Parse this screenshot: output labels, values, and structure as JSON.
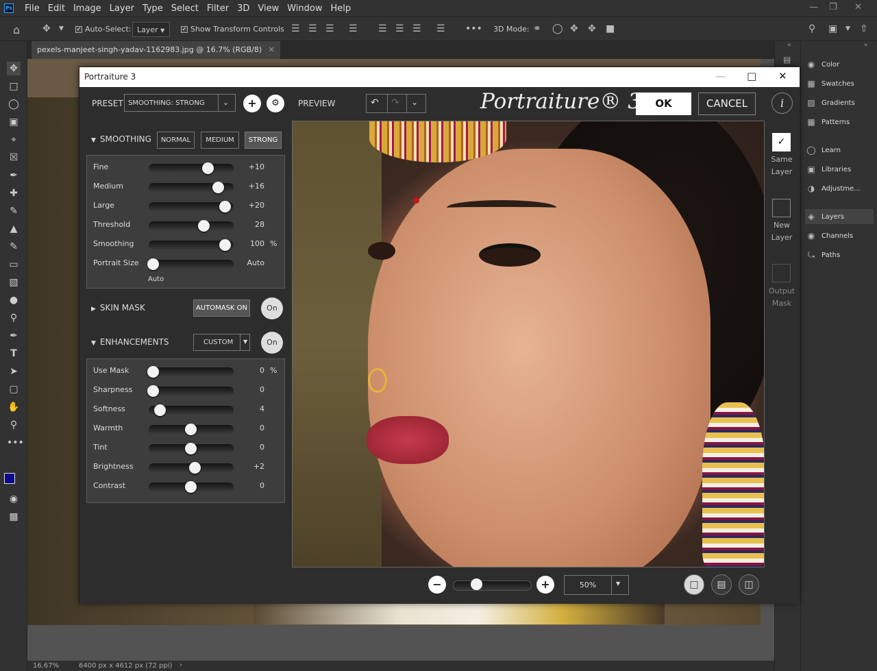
{
  "app": {
    "menu": [
      "File",
      "Edit",
      "Image",
      "Layer",
      "Type",
      "Select",
      "Filter",
      "3D",
      "View",
      "Window",
      "Help"
    ],
    "logo": "Ps"
  },
  "options": {
    "auto_select_label": "Auto-Select:",
    "auto_select_value": "Layer",
    "transform_label": "Show Transform Controls",
    "mode_label": "3D Mode:"
  },
  "document": {
    "tab_title": "pexels-manjeet-singh-yadav-1162983.jpg @ 16.7% (RGB/8)",
    "zoom": "16.67%",
    "dimensions": "6400 px x 4612 px (72 ppi)"
  },
  "panels": {
    "items": [
      {
        "label": "Color",
        "icon": "palette-icon"
      },
      {
        "label": "Swatches",
        "icon": "grid-icon"
      },
      {
        "label": "Gradients",
        "icon": "gradient-icon"
      },
      {
        "label": "Patterns",
        "icon": "pattern-icon"
      },
      {
        "label": "Learn",
        "icon": "lightbulb-icon"
      },
      {
        "label": "Libraries",
        "icon": "library-icon"
      },
      {
        "label": "Adjustme...",
        "icon": "adjustments-icon"
      },
      {
        "label": "Layers",
        "icon": "layers-icon"
      },
      {
        "label": "Channels",
        "icon": "channels-icon"
      },
      {
        "label": "Paths",
        "icon": "paths-icon"
      }
    ]
  },
  "dialog": {
    "title": "Portraiture 3",
    "preset_label": "PRESET",
    "preset_value": "SMOOTHING: STRONG",
    "preview_label": "PREVIEW",
    "logo": "Portraiture® 3",
    "ok_label": "OK",
    "cancel_label": "CANCEL",
    "info_label": "i",
    "smoothing": {
      "header": "SMOOTHING",
      "modes": [
        "NORMAL",
        "MEDIUM",
        "STRONG"
      ],
      "selected_mode": "STRONG",
      "sliders": [
        {
          "label": "Fine",
          "value": "+10",
          "unit": "",
          "level": 0.73
        },
        {
          "label": "Medium",
          "value": "+16",
          "unit": "",
          "level": 0.86
        },
        {
          "label": "Large",
          "value": "+20",
          "unit": "",
          "level": 0.95
        },
        {
          "label": "Threshold",
          "value": "28",
          "unit": "",
          "level": 0.67
        },
        {
          "label": "Smoothing",
          "value": "100",
          "unit": "%",
          "level": 0.95
        },
        {
          "label": "Portrait Size",
          "value": "Auto",
          "unit": "",
          "level": 0.0
        }
      ],
      "portrait_size_note": "Auto"
    },
    "skin_mask": {
      "header": "SKIN MASK",
      "automask_label": "AUTOMASK ON",
      "on_label": "On"
    },
    "enhancements": {
      "header": "ENHANCEMENTS",
      "custom_label": "CUSTOM",
      "on_label": "On",
      "sliders": [
        {
          "label": "Use Mask",
          "value": "0",
          "unit": "%",
          "level": 0.0
        },
        {
          "label": "Sharpness",
          "value": "0",
          "unit": "",
          "level": 0.0
        },
        {
          "label": "Softness",
          "value": "4",
          "unit": "",
          "level": 0.09
        },
        {
          "label": "Warmth",
          "value": "0",
          "unit": "",
          "level": 0.5
        },
        {
          "label": "Tint",
          "value": "0",
          "unit": "",
          "level": 0.5
        },
        {
          "label": "Brightness",
          "value": "+2",
          "unit": "",
          "level": 0.55
        },
        {
          "label": "Contrast",
          "value": "0",
          "unit": "",
          "level": 0.5
        }
      ]
    },
    "output": {
      "same_layer": "Same Layer",
      "new_layer": "New Layer",
      "output_mask": "Output Mask"
    },
    "zoom_value": "50%",
    "zoom_level": 0.25
  }
}
